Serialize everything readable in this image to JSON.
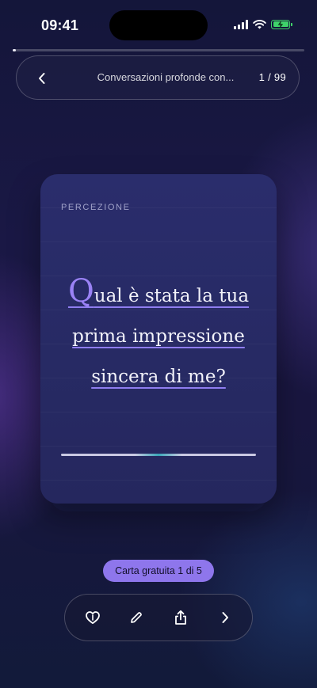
{
  "status_bar": {
    "time": "09:41",
    "icons": [
      "signal-icon",
      "wifi-icon",
      "battery-charging-icon"
    ],
    "battery_color": "#3fd36a"
  },
  "progress": {
    "fraction": 0.0101
  },
  "header": {
    "back_icon": "chevron-left-icon",
    "title": "Conversazioni profonde con...",
    "counter": "1 / 99"
  },
  "card": {
    "category": "PERCEZIONE",
    "question_initial": "Q",
    "question_line1_rest": "ual è stata la tua",
    "question_line2": "prima impressione",
    "question_line3": "sincera di me?",
    "accent_color": "#8f7df0"
  },
  "badge": {
    "label": "Carta gratuita 1 di 5",
    "color": "#8e76ec"
  },
  "actions": [
    {
      "icon": "heart-icon"
    },
    {
      "icon": "pencil-icon"
    },
    {
      "icon": "share-icon"
    },
    {
      "icon": "chevron-right-icon"
    }
  ]
}
